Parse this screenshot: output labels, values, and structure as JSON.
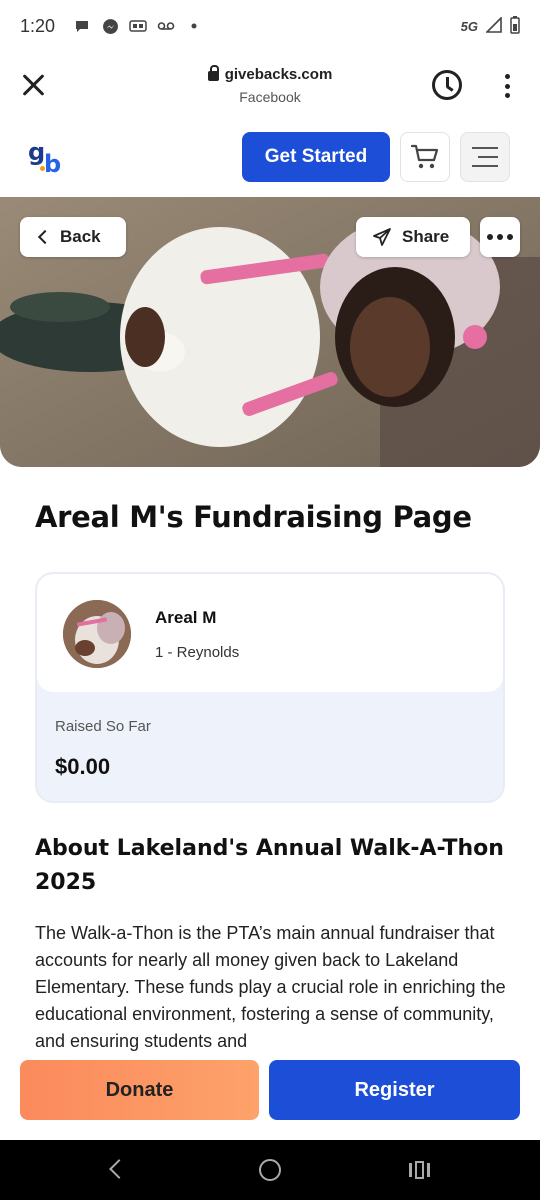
{
  "status_bar": {
    "time": "1:20",
    "network": "5G"
  },
  "browser": {
    "url": "givebacks.com",
    "subtitle": "Facebook"
  },
  "header": {
    "get_started_label": "Get Started"
  },
  "hero": {
    "back_label": "Back",
    "share_label": "Share"
  },
  "page": {
    "title": "Areal M's Fundraising Page"
  },
  "fundraiser": {
    "name": "Areal M",
    "team": "1 - Reynolds",
    "raised_label": "Raised So Far",
    "raised_amount": "$0.00"
  },
  "about": {
    "title": "About Lakeland's Annual Walk-A-Thon 2025",
    "body": "The Walk-a-Thon is the PTA’s main annual fundraiser that accounts for nearly all money given back to Lakeland Elementary. These funds play a crucial role in enriching the educational environment, fostering a sense of community, and ensuring students and"
  },
  "actions": {
    "donate_label": "Donate",
    "register_label": "Register"
  },
  "colors": {
    "primary": "#1d4ed8",
    "donate_start": "#fb8a5c",
    "donate_end": "#fda26a",
    "card_bg": "#eef2fb"
  }
}
